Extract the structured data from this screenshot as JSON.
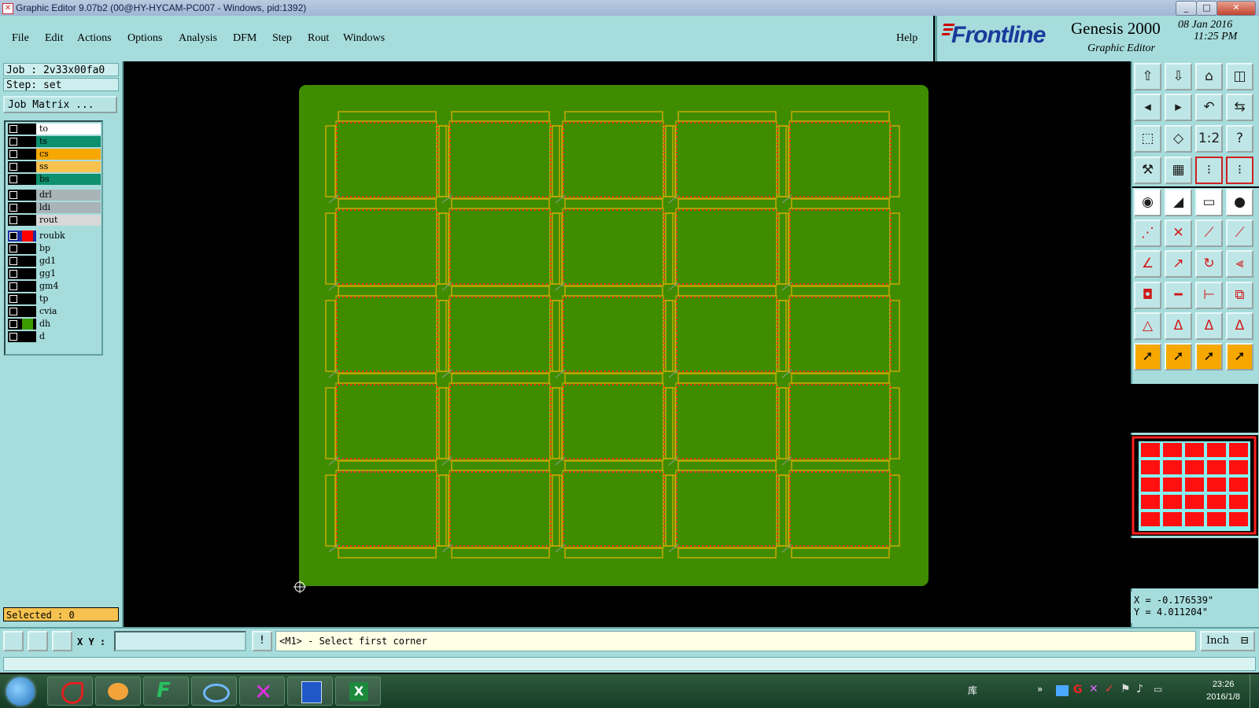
{
  "window": {
    "title": "Graphic Editor 9.07b2 (00@HY-HYCAM-PC007 - Windows, pid:1392)",
    "controls": [
      "_",
      "□",
      "✕"
    ]
  },
  "menu": [
    "File",
    "Edit",
    "Actions",
    "Options",
    "Analysis",
    "DFM",
    "Step",
    "Rout",
    "Windows"
  ],
  "help": "Help",
  "brand": {
    "logo": "Frontline",
    "product": "Genesis 2000",
    "subtitle": "Graphic Editor",
    "date": "08 Jan 2016",
    "time": "11:25 PM"
  },
  "job": {
    "job_line": "Job : 2v33x00fa0",
    "step_line": "Step: set",
    "matrix_button": "Job Matrix ..."
  },
  "layers": [
    {
      "name": "to",
      "color": "#ffffff"
    },
    {
      "name": "ts",
      "color": "#0e8f6e"
    },
    {
      "name": "cs",
      "color": "#f6a800"
    },
    {
      "name": "ss",
      "color": "#f7c24f"
    },
    {
      "name": "bs",
      "color": "#0e8f6e"
    },
    {
      "name": "drl",
      "color": "#a8b4b8"
    },
    {
      "name": "ldi",
      "color": "#a8b4b8"
    },
    {
      "name": "rout",
      "color": "#d8d8d8"
    },
    {
      "name": "roubk",
      "color": "#a6dcdc",
      "swatch": "#ff0000",
      "active": true
    },
    {
      "name": "bp",
      "color": "#a6dcdc"
    },
    {
      "name": "gd1",
      "color": "#a6dcdc"
    },
    {
      "name": "gg1",
      "color": "#a6dcdc"
    },
    {
      "name": "gm4",
      "color": "#a6dcdc"
    },
    {
      "name": "tp",
      "color": "#a6dcdc"
    },
    {
      "name": "cvia",
      "color": "#a6dcdc"
    },
    {
      "name": "dh",
      "color": "#a6dcdc",
      "swatch": "#3a9a00"
    },
    {
      "name": "d",
      "color": "#a6dcdc"
    }
  ],
  "selected": "Selected : 0",
  "coords": {
    "x": "X = -0.176539\"",
    "y": "Y = 4.011204\""
  },
  "command": {
    "xy_label": "X Y :",
    "xy_value": "",
    "prompt": "<M1> - Select first corner",
    "unit": "Inch"
  },
  "panel": {
    "rows": 5,
    "cols": 5,
    "board_color": "#3f8c00",
    "outline_color": "#c8a800",
    "rout_color": "#ff2a2a"
  },
  "taskbar": {
    "library": "库",
    "time": "23:26",
    "date": "2016/1/8"
  }
}
